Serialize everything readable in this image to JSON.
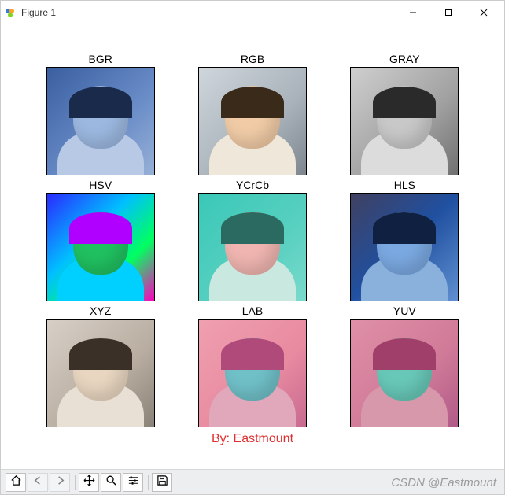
{
  "window": {
    "title": "Figure 1"
  },
  "chart_data": [
    {
      "type": "image",
      "title": "BGR",
      "colorspace": "BGR"
    },
    {
      "type": "image",
      "title": "RGB",
      "colorspace": "RGB"
    },
    {
      "type": "image",
      "title": "GRAY",
      "colorspace": "GRAY"
    },
    {
      "type": "image",
      "title": "HSV",
      "colorspace": "HSV"
    },
    {
      "type": "image",
      "title": "YCrCb",
      "colorspace": "YCrCb"
    },
    {
      "type": "image",
      "title": "HLS",
      "colorspace": "HLS"
    },
    {
      "type": "image",
      "title": "XYZ",
      "colorspace": "XYZ"
    },
    {
      "type": "image",
      "title": "LAB",
      "colorspace": "LAB"
    },
    {
      "type": "image",
      "title": "YUV",
      "colorspace": "YUV"
    }
  ],
  "suptitle": "By: Eastmount",
  "toolbar": {
    "home": "home-icon",
    "back": "back-icon",
    "forward": "forward-icon",
    "pan": "pan-icon",
    "zoom": "zoom-icon",
    "config": "config-icon",
    "save": "save-icon"
  },
  "watermark": "CSDN @Eastmount"
}
